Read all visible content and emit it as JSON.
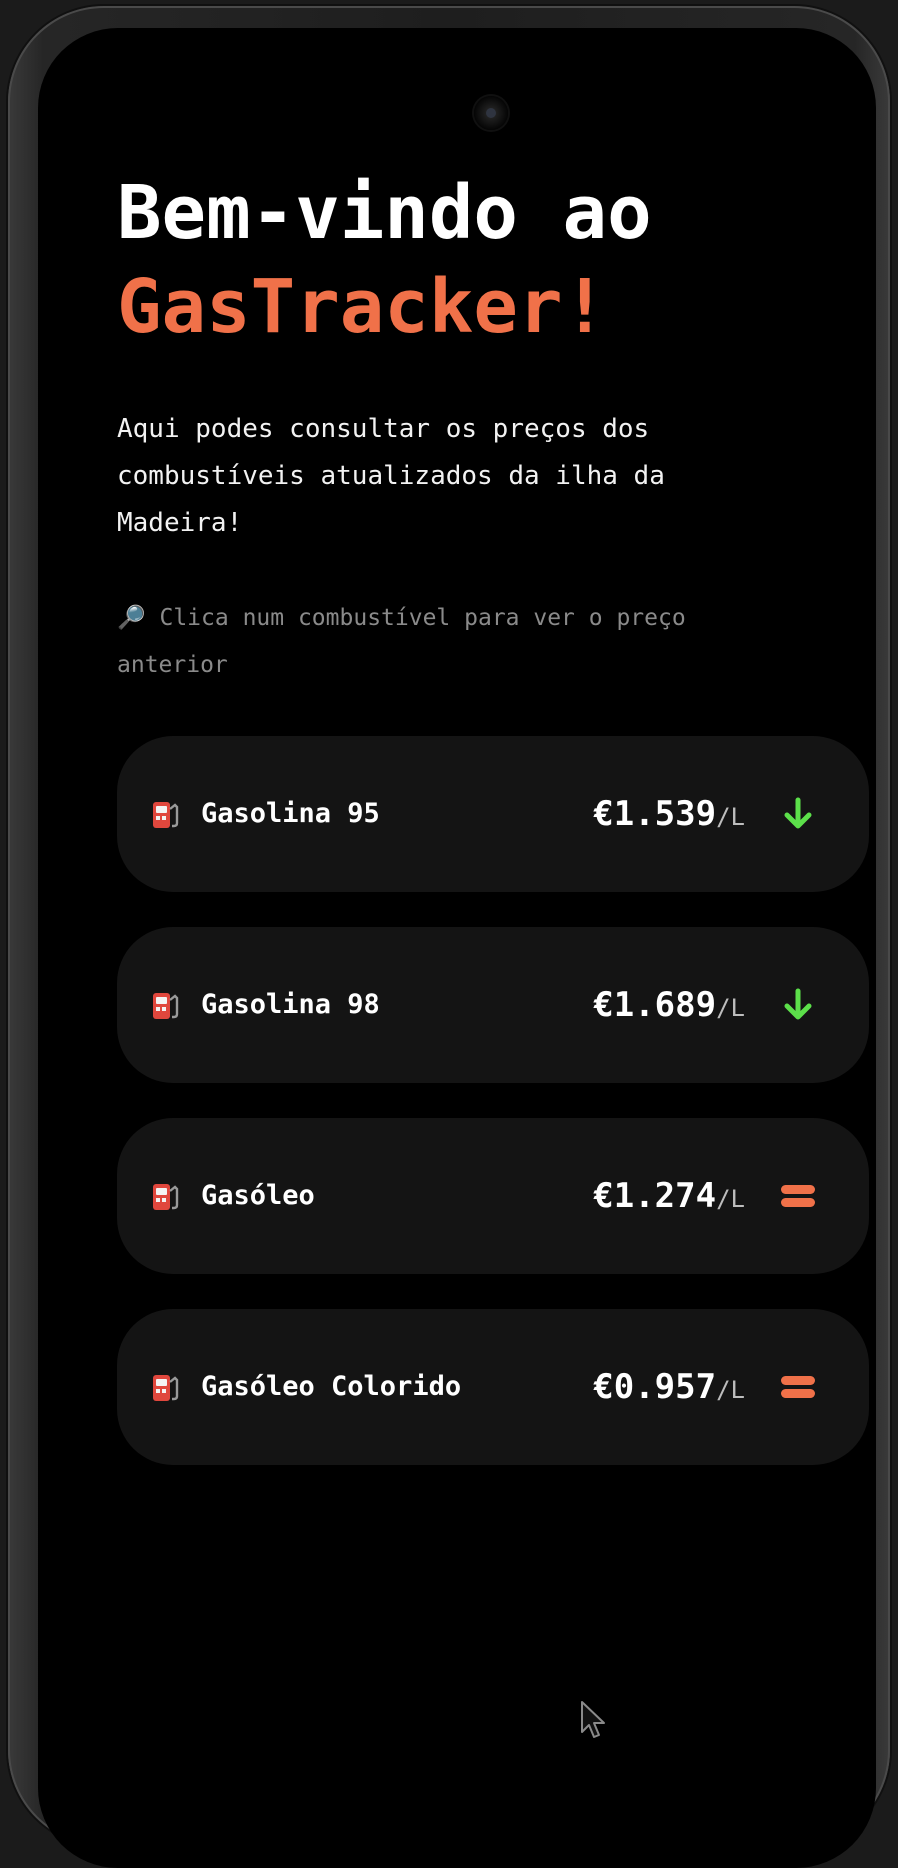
{
  "header": {
    "title_line1": "Bem-vindo ao",
    "title_brand": "GasTracker!",
    "intro": "Aqui podes consultar os preços dos combustíveis atualizados da ilha da Madeira!",
    "hint": "🔎 Clica num combustível para ver o preço anterior"
  },
  "colors": {
    "background": "#000000",
    "card": "#141414",
    "accent": "#f07149",
    "trend_down": "#5ce04a",
    "trend_same": "#f07149"
  },
  "fuels": [
    {
      "icon": "fuel-pump-icon",
      "name": "Gasolina 95",
      "price": "€1.539",
      "unit": "/L",
      "trend": "down",
      "trend_icon": "arrow-down-icon"
    },
    {
      "icon": "fuel-pump-icon",
      "name": "Gasolina 98",
      "price": "€1.689",
      "unit": "/L",
      "trend": "down",
      "trend_icon": "arrow-down-icon"
    },
    {
      "icon": "fuel-pump-icon",
      "name": "Gasóleo",
      "price": "€1.274",
      "unit": "/L",
      "trend": "same",
      "trend_icon": "equals-icon"
    },
    {
      "icon": "fuel-pump-icon",
      "name": "Gasóleo Colorido",
      "price": "€0.957",
      "unit": "/L",
      "trend": "same",
      "trend_icon": "equals-icon"
    }
  ]
}
